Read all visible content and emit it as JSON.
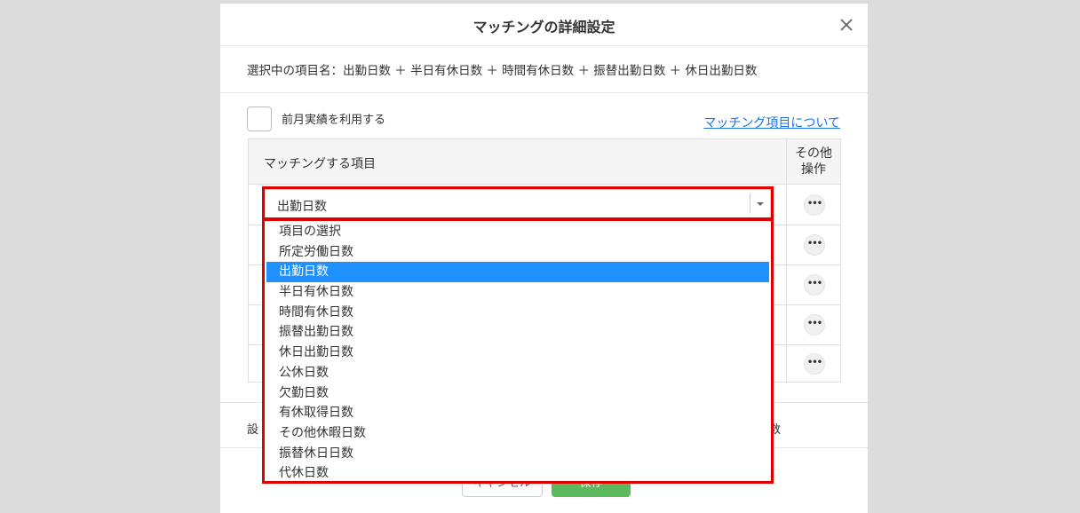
{
  "modal": {
    "title": "マッチングの詳細設定",
    "selected_items": "選択中の項目名：出勤日数 ＋ 半日有休日数 ＋ 時間有休日数 ＋ 振替出勤日数 ＋ 休日出勤日数",
    "use_prev_month_label": "前月実績を利用する",
    "use_prev_month_checked": false,
    "help_link": "マッチング項目について",
    "table": {
      "header_item": "マッチングする項目",
      "header_ops_line1": "その他",
      "header_ops_line2": "操作",
      "more_label": "•••"
    },
    "setting_label": "設",
    "setting_tail": "数",
    "cancel_label": "キャンセル",
    "save_label": "保存"
  },
  "select": {
    "value": "出勤日数",
    "options": [
      "項目の選択",
      "所定労働日数",
      "出勤日数",
      "半日有休日数",
      "時間有休日数",
      "振替出勤日数",
      "休日出勤日数",
      "公休日数",
      "欠勤日数",
      "有休取得日数",
      "その他休暇日数",
      "振替休日日数",
      "代休日数"
    ],
    "selected_index": 2
  },
  "colors": {
    "highlight": "#e00000",
    "active_option": "#1e90ff",
    "save_button": "#5cb85c",
    "link": "#1a73e8"
  }
}
